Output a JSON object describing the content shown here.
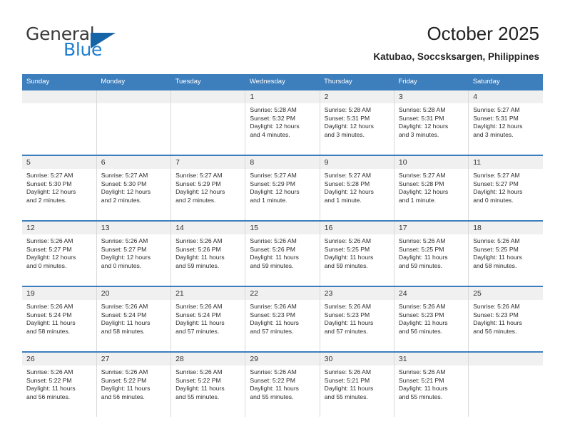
{
  "brand": {
    "name_top": "General",
    "name_bottom": "Blue",
    "triangle_icon": "triangle-icon",
    "accent_color": "#1f7fd0"
  },
  "header": {
    "title": "October 2025",
    "subtitle": "Katubao, Soccsksargen, Philippines"
  },
  "theme": {
    "header_bar": "#3d7ebd",
    "day_band": "#f0f0f0",
    "cell_border": "#d9d9d9"
  },
  "weekdays": [
    "Sunday",
    "Monday",
    "Tuesday",
    "Wednesday",
    "Thursday",
    "Friday",
    "Saturday"
  ],
  "weeks": [
    [
      {
        "day": "",
        "lines": []
      },
      {
        "day": "",
        "lines": []
      },
      {
        "day": "",
        "lines": []
      },
      {
        "day": "1",
        "lines": [
          "Sunrise: 5:28 AM",
          "Sunset: 5:32 PM",
          "Daylight: 12 hours",
          "and 4 minutes."
        ]
      },
      {
        "day": "2",
        "lines": [
          "Sunrise: 5:28 AM",
          "Sunset: 5:31 PM",
          "Daylight: 12 hours",
          "and 3 minutes."
        ]
      },
      {
        "day": "3",
        "lines": [
          "Sunrise: 5:28 AM",
          "Sunset: 5:31 PM",
          "Daylight: 12 hours",
          "and 3 minutes."
        ]
      },
      {
        "day": "4",
        "lines": [
          "Sunrise: 5:27 AM",
          "Sunset: 5:31 PM",
          "Daylight: 12 hours",
          "and 3 minutes."
        ]
      }
    ],
    [
      {
        "day": "5",
        "lines": [
          "Sunrise: 5:27 AM",
          "Sunset: 5:30 PM",
          "Daylight: 12 hours",
          "and 2 minutes."
        ]
      },
      {
        "day": "6",
        "lines": [
          "Sunrise: 5:27 AM",
          "Sunset: 5:30 PM",
          "Daylight: 12 hours",
          "and 2 minutes."
        ]
      },
      {
        "day": "7",
        "lines": [
          "Sunrise: 5:27 AM",
          "Sunset: 5:29 PM",
          "Daylight: 12 hours",
          "and 2 minutes."
        ]
      },
      {
        "day": "8",
        "lines": [
          "Sunrise: 5:27 AM",
          "Sunset: 5:29 PM",
          "Daylight: 12 hours",
          "and 1 minute."
        ]
      },
      {
        "day": "9",
        "lines": [
          "Sunrise: 5:27 AM",
          "Sunset: 5:28 PM",
          "Daylight: 12 hours",
          "and 1 minute."
        ]
      },
      {
        "day": "10",
        "lines": [
          "Sunrise: 5:27 AM",
          "Sunset: 5:28 PM",
          "Daylight: 12 hours",
          "and 1 minute."
        ]
      },
      {
        "day": "11",
        "lines": [
          "Sunrise: 5:27 AM",
          "Sunset: 5:27 PM",
          "Daylight: 12 hours",
          "and 0 minutes."
        ]
      }
    ],
    [
      {
        "day": "12",
        "lines": [
          "Sunrise: 5:26 AM",
          "Sunset: 5:27 PM",
          "Daylight: 12 hours",
          "and 0 minutes."
        ]
      },
      {
        "day": "13",
        "lines": [
          "Sunrise: 5:26 AM",
          "Sunset: 5:27 PM",
          "Daylight: 12 hours",
          "and 0 minutes."
        ]
      },
      {
        "day": "14",
        "lines": [
          "Sunrise: 5:26 AM",
          "Sunset: 5:26 PM",
          "Daylight: 11 hours",
          "and 59 minutes."
        ]
      },
      {
        "day": "15",
        "lines": [
          "Sunrise: 5:26 AM",
          "Sunset: 5:26 PM",
          "Daylight: 11 hours",
          "and 59 minutes."
        ]
      },
      {
        "day": "16",
        "lines": [
          "Sunrise: 5:26 AM",
          "Sunset: 5:25 PM",
          "Daylight: 11 hours",
          "and 59 minutes."
        ]
      },
      {
        "day": "17",
        "lines": [
          "Sunrise: 5:26 AM",
          "Sunset: 5:25 PM",
          "Daylight: 11 hours",
          "and 59 minutes."
        ]
      },
      {
        "day": "18",
        "lines": [
          "Sunrise: 5:26 AM",
          "Sunset: 5:25 PM",
          "Daylight: 11 hours",
          "and 58 minutes."
        ]
      }
    ],
    [
      {
        "day": "19",
        "lines": [
          "Sunrise: 5:26 AM",
          "Sunset: 5:24 PM",
          "Daylight: 11 hours",
          "and 58 minutes."
        ]
      },
      {
        "day": "20",
        "lines": [
          "Sunrise: 5:26 AM",
          "Sunset: 5:24 PM",
          "Daylight: 11 hours",
          "and 58 minutes."
        ]
      },
      {
        "day": "21",
        "lines": [
          "Sunrise: 5:26 AM",
          "Sunset: 5:24 PM",
          "Daylight: 11 hours",
          "and 57 minutes."
        ]
      },
      {
        "day": "22",
        "lines": [
          "Sunrise: 5:26 AM",
          "Sunset: 5:23 PM",
          "Daylight: 11 hours",
          "and 57 minutes."
        ]
      },
      {
        "day": "23",
        "lines": [
          "Sunrise: 5:26 AM",
          "Sunset: 5:23 PM",
          "Daylight: 11 hours",
          "and 57 minutes."
        ]
      },
      {
        "day": "24",
        "lines": [
          "Sunrise: 5:26 AM",
          "Sunset: 5:23 PM",
          "Daylight: 11 hours",
          "and 56 minutes."
        ]
      },
      {
        "day": "25",
        "lines": [
          "Sunrise: 5:26 AM",
          "Sunset: 5:23 PM",
          "Daylight: 11 hours",
          "and 56 minutes."
        ]
      }
    ],
    [
      {
        "day": "26",
        "lines": [
          "Sunrise: 5:26 AM",
          "Sunset: 5:22 PM",
          "Daylight: 11 hours",
          "and 56 minutes."
        ]
      },
      {
        "day": "27",
        "lines": [
          "Sunrise: 5:26 AM",
          "Sunset: 5:22 PM",
          "Daylight: 11 hours",
          "and 56 minutes."
        ]
      },
      {
        "day": "28",
        "lines": [
          "Sunrise: 5:26 AM",
          "Sunset: 5:22 PM",
          "Daylight: 11 hours",
          "and 55 minutes."
        ]
      },
      {
        "day": "29",
        "lines": [
          "Sunrise: 5:26 AM",
          "Sunset: 5:22 PM",
          "Daylight: 11 hours",
          "and 55 minutes."
        ]
      },
      {
        "day": "30",
        "lines": [
          "Sunrise: 5:26 AM",
          "Sunset: 5:21 PM",
          "Daylight: 11 hours",
          "and 55 minutes."
        ]
      },
      {
        "day": "31",
        "lines": [
          "Sunrise: 5:26 AM",
          "Sunset: 5:21 PM",
          "Daylight: 11 hours",
          "and 55 minutes."
        ]
      },
      {
        "day": "",
        "lines": []
      }
    ]
  ]
}
